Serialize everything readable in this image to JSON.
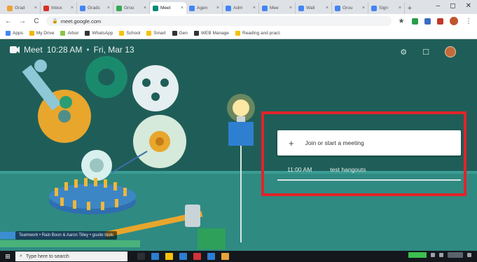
{
  "browser": {
    "tabs": [
      {
        "label": "Grad",
        "color": "#e8a33b",
        "active": false
      },
      {
        "label": "Inbox",
        "color": "#d93025",
        "active": false
      },
      {
        "label": "Grads",
        "color": "#4285f4",
        "active": false
      },
      {
        "label": "Grou",
        "color": "#34a853",
        "active": false
      },
      {
        "label": "Meet",
        "color": "#00897b",
        "active": true
      },
      {
        "label": "Agen",
        "color": "#4285f4",
        "active": false
      },
      {
        "label": "Adm",
        "color": "#4285f4",
        "active": false
      },
      {
        "label": "Mee",
        "color": "#4285f4",
        "active": false
      },
      {
        "label": "Wall",
        "color": "#4285f4",
        "active": false
      },
      {
        "label": "Grou",
        "color": "#4285f4",
        "active": false
      },
      {
        "label": "Sign",
        "color": "#4285f4",
        "active": false
      }
    ],
    "new_tab_label": "+",
    "window_controls": {
      "minimize": "–",
      "maximize": "◻",
      "close": "✕"
    },
    "url": "meet.google.com",
    "bookmarks": [
      {
        "label": "Apps",
        "color": "#4285f4"
      },
      {
        "label": "My Drive",
        "color": "#f4b400"
      },
      {
        "label": "Arbor",
        "color": "#8bc34a"
      },
      {
        "label": "WhatsApp",
        "color": "#333333"
      },
      {
        "label": "School",
        "color": "#f4c20d"
      },
      {
        "label": "Smart",
        "color": "#f4c20d"
      },
      {
        "label": "Gen",
        "color": "#333333"
      },
      {
        "label": "WEB Manage",
        "color": "#333333"
      },
      {
        "label": "Reading and pract.",
        "color": "#f4c20d"
      }
    ]
  },
  "meet": {
    "app_name": "Meet",
    "time": "10:28 AM",
    "separator": "•",
    "date": "Fri, Mar 13",
    "join_label": "Join or start a meeting",
    "join_icon": "plus-icon",
    "meetings": [
      {
        "time": "11:00 AM",
        "title": "test hangouts"
      }
    ],
    "caption": "Teamwork • Rain Boon & Aaron Tilley • gsuite tools",
    "highlight_color": "#e0242b"
  },
  "taskbar": {
    "search_placeholder": "Type here to search",
    "apps": [
      "#2b2f36",
      "#2d7dd2",
      "#f4c20d",
      "#2d7dd2",
      "#d13438",
      "#2d7dd2",
      "#e8a33b"
    ]
  }
}
